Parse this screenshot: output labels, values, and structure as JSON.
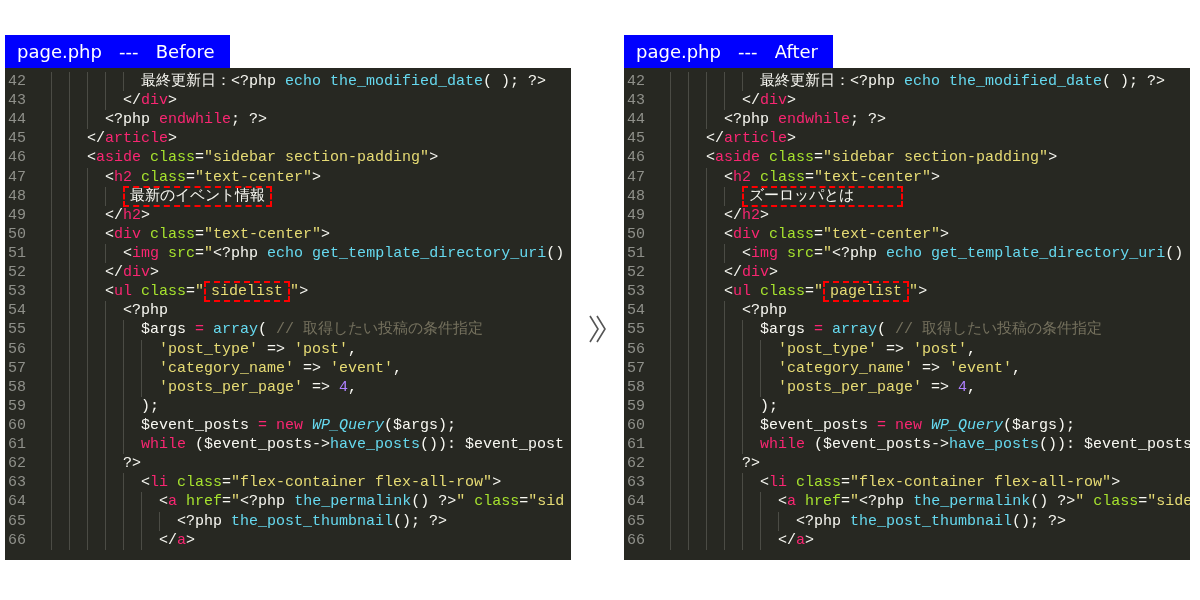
{
  "panels": [
    {
      "title": "page.php   ---   Before",
      "lines": [
        {
          "number": "42",
          "tokens": [
            {
              "kind": "plain",
              "text": "          最終更新日：<?php "
            },
            {
              "kind": "func",
              "text": "echo the_modified_date"
            },
            {
              "kind": "plain",
              "text": "( ); ?>"
            }
          ]
        },
        {
          "number": "43",
          "tokens": [
            {
              "kind": "plain",
              "text": "        </"
            },
            {
              "kind": "tag",
              "text": "div"
            },
            {
              "kind": "plain",
              "text": ">"
            }
          ]
        },
        {
          "number": "44",
          "tokens": [
            {
              "kind": "plain",
              "text": "      <?php "
            },
            {
              "kind": "keyword",
              "text": "endwhile"
            },
            {
              "kind": "plain",
              "text": "; ?>"
            }
          ]
        },
        {
          "number": "45",
          "tokens": [
            {
              "kind": "plain",
              "text": "    </"
            },
            {
              "kind": "tag",
              "text": "article"
            },
            {
              "kind": "plain",
              "text": ">"
            }
          ]
        },
        {
          "number": "46",
          "tokens": [
            {
              "kind": "plain",
              "text": "    <"
            },
            {
              "kind": "tag",
              "text": "aside"
            },
            {
              "kind": "attr",
              "text": " class"
            },
            {
              "kind": "plain",
              "text": "="
            },
            {
              "kind": "string",
              "text": "\"sidebar section-padding\""
            },
            {
              "kind": "plain",
              "text": ">"
            }
          ]
        },
        {
          "number": "47",
          "tokens": [
            {
              "kind": "plain",
              "text": "      <"
            },
            {
              "kind": "tag",
              "text": "h2"
            },
            {
              "kind": "attr",
              "text": " class"
            },
            {
              "kind": "plain",
              "text": "="
            },
            {
              "kind": "string",
              "text": "\"text-center\""
            },
            {
              "kind": "plain",
              "text": ">"
            }
          ]
        },
        {
          "number": "48",
          "tokens": [
            {
              "kind": "plain",
              "text": "        最新のイベント情報",
              "boxed": true
            }
          ]
        },
        {
          "number": "49",
          "tokens": [
            {
              "kind": "plain",
              "text": "      </"
            },
            {
              "kind": "tag",
              "text": "h2"
            },
            {
              "kind": "plain",
              "text": ">"
            }
          ]
        },
        {
          "number": "50",
          "tokens": [
            {
              "kind": "plain",
              "text": "      <"
            },
            {
              "kind": "tag",
              "text": "div"
            },
            {
              "kind": "attr",
              "text": " class"
            },
            {
              "kind": "plain",
              "text": "="
            },
            {
              "kind": "string",
              "text": "\"text-center\""
            },
            {
              "kind": "plain",
              "text": ">"
            }
          ]
        },
        {
          "number": "51",
          "tokens": [
            {
              "kind": "plain",
              "text": "        <"
            },
            {
              "kind": "tag",
              "text": "img"
            },
            {
              "kind": "attr",
              "text": " src"
            },
            {
              "kind": "plain",
              "text": "="
            },
            {
              "kind": "string",
              "text": "\""
            },
            {
              "kind": "plain",
              "text": "<?php "
            },
            {
              "kind": "func",
              "text": "echo get_template_directory_uri"
            },
            {
              "kind": "plain",
              "text": "()"
            }
          ]
        },
        {
          "number": "52",
          "tokens": [
            {
              "kind": "plain",
              "text": "      </"
            },
            {
              "kind": "tag",
              "text": "div"
            },
            {
              "kind": "plain",
              "text": ">"
            }
          ]
        },
        {
          "number": "53",
          "tokens": [
            {
              "kind": "plain",
              "text": "      <"
            },
            {
              "kind": "tag",
              "text": "ul"
            },
            {
              "kind": "attr",
              "text": " class"
            },
            {
              "kind": "plain",
              "text": "="
            },
            {
              "kind": "string",
              "text": "\""
            },
            {
              "kind": "string",
              "text": "sidelist",
              "boxed": true
            },
            {
              "kind": "string",
              "text": "\""
            },
            {
              "kind": "plain",
              "text": ">"
            }
          ]
        },
        {
          "number": "54",
          "tokens": [
            {
              "kind": "plain",
              "text": "        <?php"
            }
          ]
        },
        {
          "number": "55",
          "tokens": [
            {
              "kind": "plain",
              "text": "          $args "
            },
            {
              "kind": "keyword",
              "text": "="
            },
            {
              "kind": "func",
              "text": " array"
            },
            {
              "kind": "plain",
              "text": "( "
            },
            {
              "kind": "comment",
              "text": "// 取得したい投稿の条件指定"
            }
          ]
        },
        {
          "number": "56",
          "tokens": [
            {
              "kind": "string",
              "text": "            'post_type'"
            },
            {
              "kind": "plain",
              "text": " => "
            },
            {
              "kind": "string",
              "text": "'post'"
            },
            {
              "kind": "plain",
              "text": ","
            }
          ]
        },
        {
          "number": "57",
          "tokens": [
            {
              "kind": "string",
              "text": "            'category_name'"
            },
            {
              "kind": "plain",
              "text": " => "
            },
            {
              "kind": "string",
              "text": "'event'"
            },
            {
              "kind": "plain",
              "text": ","
            }
          ]
        },
        {
          "number": "58",
          "tokens": [
            {
              "kind": "string",
              "text": "            'posts_per_page'"
            },
            {
              "kind": "plain",
              "text": " => "
            },
            {
              "kind": "number",
              "text": "4"
            },
            {
              "kind": "plain",
              "text": ","
            }
          ]
        },
        {
          "number": "59",
          "tokens": [
            {
              "kind": "plain",
              "text": "          );"
            }
          ]
        },
        {
          "number": "60",
          "tokens": [
            {
              "kind": "plain",
              "text": "          $event_posts "
            },
            {
              "kind": "keyword",
              "text": "= new"
            },
            {
              "kind": "class",
              "text": " WP_Query"
            },
            {
              "kind": "plain",
              "text": "($args);"
            }
          ]
        },
        {
          "number": "61",
          "tokens": [
            {
              "kind": "keyword",
              "text": "          while"
            },
            {
              "kind": "plain",
              "text": " ($event_posts->"
            },
            {
              "kind": "func",
              "text": "have_posts"
            },
            {
              "kind": "plain",
              "text": "()): $event_post"
            }
          ]
        },
        {
          "number": "62",
          "tokens": [
            {
              "kind": "plain",
              "text": "        ?>"
            }
          ]
        },
        {
          "number": "63",
          "tokens": [
            {
              "kind": "plain",
              "text": "          <"
            },
            {
              "kind": "tag",
              "text": "li"
            },
            {
              "kind": "attr",
              "text": " class"
            },
            {
              "kind": "plain",
              "text": "="
            },
            {
              "kind": "string",
              "text": "\"flex-container flex-all-row\""
            },
            {
              "kind": "plain",
              "text": ">"
            }
          ]
        },
        {
          "number": "64",
          "tokens": [
            {
              "kind": "plain",
              "text": "            <"
            },
            {
              "kind": "tag",
              "text": "a"
            },
            {
              "kind": "attr",
              "text": " href"
            },
            {
              "kind": "plain",
              "text": "="
            },
            {
              "kind": "string",
              "text": "\""
            },
            {
              "kind": "plain",
              "text": "<?php "
            },
            {
              "kind": "func",
              "text": "the_permalink"
            },
            {
              "kind": "plain",
              "text": "() ?>"
            },
            {
              "kind": "string",
              "text": "\""
            },
            {
              "kind": "attr",
              "text": " class"
            },
            {
              "kind": "plain",
              "text": "="
            },
            {
              "kind": "string",
              "text": "\"sid"
            }
          ]
        },
        {
          "number": "65",
          "tokens": [
            {
              "kind": "plain",
              "text": "              <?php "
            },
            {
              "kind": "func",
              "text": "the_post_thumbnail"
            },
            {
              "kind": "plain",
              "text": "(); ?>"
            }
          ]
        },
        {
          "number": "66",
          "tokens": [
            {
              "kind": "plain",
              "text": "            </"
            },
            {
              "kind": "tag",
              "text": "a"
            },
            {
              "kind": "plain",
              "text": ">"
            }
          ]
        }
      ]
    },
    {
      "title": "page.php   ---   After",
      "lines": [
        {
          "number": "42",
          "tokens": [
            {
              "kind": "plain",
              "text": "          最終更新日：<?php "
            },
            {
              "kind": "func",
              "text": "echo the_modified_date"
            },
            {
              "kind": "plain",
              "text": "( ); ?>"
            }
          ]
        },
        {
          "number": "43",
          "tokens": [
            {
              "kind": "plain",
              "text": "        </"
            },
            {
              "kind": "tag",
              "text": "div"
            },
            {
              "kind": "plain",
              "text": ">"
            }
          ]
        },
        {
          "number": "44",
          "tokens": [
            {
              "kind": "plain",
              "text": "      <?php "
            },
            {
              "kind": "keyword",
              "text": "endwhile"
            },
            {
              "kind": "plain",
              "text": "; ?>"
            }
          ]
        },
        {
          "number": "45",
          "tokens": [
            {
              "kind": "plain",
              "text": "    </"
            },
            {
              "kind": "tag",
              "text": "article"
            },
            {
              "kind": "plain",
              "text": ">"
            }
          ]
        },
        {
          "number": "46",
          "tokens": [
            {
              "kind": "plain",
              "text": "    <"
            },
            {
              "kind": "tag",
              "text": "aside"
            },
            {
              "kind": "attr",
              "text": " class"
            },
            {
              "kind": "plain",
              "text": "="
            },
            {
              "kind": "string",
              "text": "\"sidebar section-padding\""
            },
            {
              "kind": "plain",
              "text": ">"
            }
          ]
        },
        {
          "number": "47",
          "tokens": [
            {
              "kind": "plain",
              "text": "      <"
            },
            {
              "kind": "tag",
              "text": "h2"
            },
            {
              "kind": "attr",
              "text": " class"
            },
            {
              "kind": "plain",
              "text": "="
            },
            {
              "kind": "string",
              "text": "\"text-center\""
            },
            {
              "kind": "plain",
              "text": ">"
            }
          ]
        },
        {
          "number": "48",
          "tokens": [
            {
              "kind": "plain",
              "text": "        ズーロッパとは",
              "boxed": true
            }
          ]
        },
        {
          "number": "49",
          "tokens": [
            {
              "kind": "plain",
              "text": "      </"
            },
            {
              "kind": "tag",
              "text": "h2"
            },
            {
              "kind": "plain",
              "text": ">"
            }
          ]
        },
        {
          "number": "50",
          "tokens": [
            {
              "kind": "plain",
              "text": "      <"
            },
            {
              "kind": "tag",
              "text": "div"
            },
            {
              "kind": "attr",
              "text": " class"
            },
            {
              "kind": "plain",
              "text": "="
            },
            {
              "kind": "string",
              "text": "\"text-center\""
            },
            {
              "kind": "plain",
              "text": ">"
            }
          ]
        },
        {
          "number": "51",
          "tokens": [
            {
              "kind": "plain",
              "text": "        <"
            },
            {
              "kind": "tag",
              "text": "img"
            },
            {
              "kind": "attr",
              "text": " src"
            },
            {
              "kind": "plain",
              "text": "="
            },
            {
              "kind": "string",
              "text": "\""
            },
            {
              "kind": "plain",
              "text": "<?php "
            },
            {
              "kind": "func",
              "text": "echo get_template_directory_uri"
            },
            {
              "kind": "plain",
              "text": "()"
            }
          ]
        },
        {
          "number": "52",
          "tokens": [
            {
              "kind": "plain",
              "text": "      </"
            },
            {
              "kind": "tag",
              "text": "div"
            },
            {
              "kind": "plain",
              "text": ">"
            }
          ]
        },
        {
          "number": "53",
          "tokens": [
            {
              "kind": "plain",
              "text": "      <"
            },
            {
              "kind": "tag",
              "text": "ul"
            },
            {
              "kind": "attr",
              "text": " class"
            },
            {
              "kind": "plain",
              "text": "="
            },
            {
              "kind": "string",
              "text": "\""
            },
            {
              "kind": "string",
              "text": "pagelist",
              "boxed": true
            },
            {
              "kind": "string",
              "text": "\""
            },
            {
              "kind": "plain",
              "text": ">"
            }
          ]
        },
        {
          "number": "54",
          "tokens": [
            {
              "kind": "plain",
              "text": "        <?php"
            }
          ]
        },
        {
          "number": "55",
          "tokens": [
            {
              "kind": "plain",
              "text": "          $args "
            },
            {
              "kind": "keyword",
              "text": "="
            },
            {
              "kind": "func",
              "text": " array"
            },
            {
              "kind": "plain",
              "text": "( "
            },
            {
              "kind": "comment",
              "text": "// 取得したい投稿の条件指定"
            }
          ]
        },
        {
          "number": "56",
          "tokens": [
            {
              "kind": "string",
              "text": "            'post_type'"
            },
            {
              "kind": "plain",
              "text": " => "
            },
            {
              "kind": "string",
              "text": "'post'"
            },
            {
              "kind": "plain",
              "text": ","
            }
          ]
        },
        {
          "number": "57",
          "tokens": [
            {
              "kind": "string",
              "text": "            'category_name'"
            },
            {
              "kind": "plain",
              "text": " => "
            },
            {
              "kind": "string",
              "text": "'event'"
            },
            {
              "kind": "plain",
              "text": ","
            }
          ]
        },
        {
          "number": "58",
          "tokens": [
            {
              "kind": "string",
              "text": "            'posts_per_page'"
            },
            {
              "kind": "plain",
              "text": " => "
            },
            {
              "kind": "number",
              "text": "4"
            },
            {
              "kind": "plain",
              "text": ","
            }
          ]
        },
        {
          "number": "59",
          "tokens": [
            {
              "kind": "plain",
              "text": "          );"
            }
          ]
        },
        {
          "number": "60",
          "tokens": [
            {
              "kind": "plain",
              "text": "          $event_posts "
            },
            {
              "kind": "keyword",
              "text": "= new"
            },
            {
              "kind": "class",
              "text": " WP_Query"
            },
            {
              "kind": "plain",
              "text": "($args);"
            }
          ]
        },
        {
          "number": "61",
          "tokens": [
            {
              "kind": "keyword",
              "text": "          while"
            },
            {
              "kind": "plain",
              "text": " ($event_posts->"
            },
            {
              "kind": "func",
              "text": "have_posts"
            },
            {
              "kind": "plain",
              "text": "()): $event_posts"
            }
          ]
        },
        {
          "number": "62",
          "tokens": [
            {
              "kind": "plain",
              "text": "        ?>"
            }
          ]
        },
        {
          "number": "63",
          "tokens": [
            {
              "kind": "plain",
              "text": "          <"
            },
            {
              "kind": "tag",
              "text": "li"
            },
            {
              "kind": "attr",
              "text": " class"
            },
            {
              "kind": "plain",
              "text": "="
            },
            {
              "kind": "string",
              "text": "\"flex-container flex-all-row\""
            },
            {
              "kind": "plain",
              "text": ">"
            }
          ]
        },
        {
          "number": "64",
          "tokens": [
            {
              "kind": "plain",
              "text": "            <"
            },
            {
              "kind": "tag",
              "text": "a"
            },
            {
              "kind": "attr",
              "text": " href"
            },
            {
              "kind": "plain",
              "text": "="
            },
            {
              "kind": "string",
              "text": "\""
            },
            {
              "kind": "plain",
              "text": "<?php "
            },
            {
              "kind": "func",
              "text": "the_permalink"
            },
            {
              "kind": "plain",
              "text": "() ?>"
            },
            {
              "kind": "string",
              "text": "\""
            },
            {
              "kind": "attr",
              "text": " class"
            },
            {
              "kind": "plain",
              "text": "="
            },
            {
              "kind": "string",
              "text": "\"side"
            }
          ]
        },
        {
          "number": "65",
          "tokens": [
            {
              "kind": "plain",
              "text": "              <?php "
            },
            {
              "kind": "func",
              "text": "the_post_thumbnail"
            },
            {
              "kind": "plain",
              "text": "(); ?>"
            }
          ]
        },
        {
          "number": "66",
          "tokens": [
            {
              "kind": "plain",
              "text": "            </"
            },
            {
              "kind": "tag",
              "text": "a"
            },
            {
              "kind": "plain",
              "text": ">"
            }
          ]
        }
      ]
    }
  ]
}
